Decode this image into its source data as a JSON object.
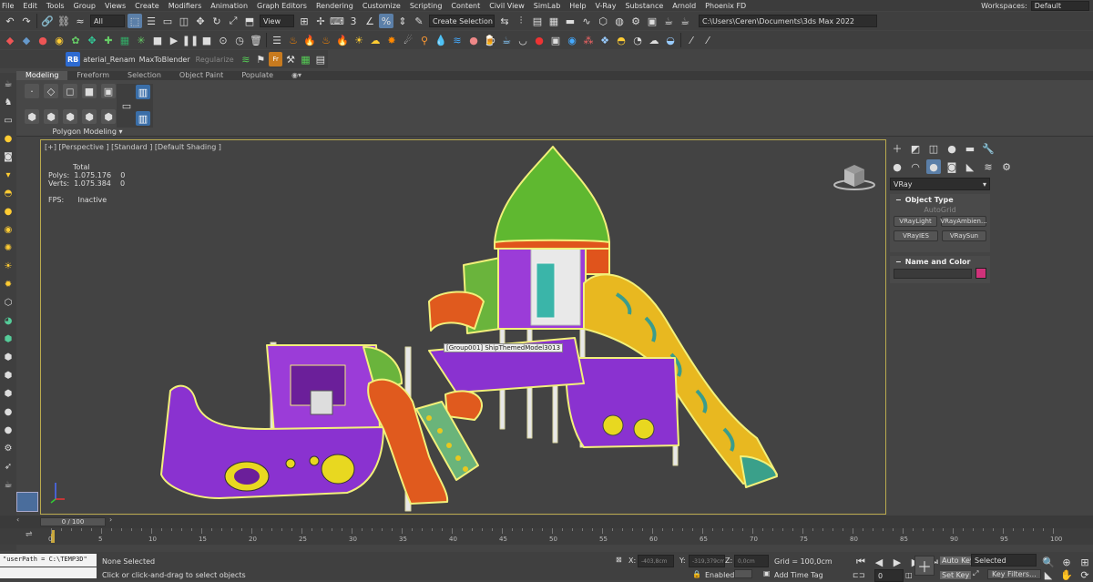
{
  "menu": {
    "items": [
      "File",
      "Edit",
      "Tools",
      "Group",
      "Views",
      "Create",
      "Modifiers",
      "Animation",
      "Graph Editors",
      "Rendering",
      "Customize",
      "Scripting",
      "Content",
      "Civil View",
      "SimLab",
      "Help",
      "V-Ray",
      "Substance",
      "Arnold",
      "Phoenix FD"
    ],
    "workspaces_label": "Workspaces:",
    "workspaces_value": "Default"
  },
  "toolbar1": {
    "filter": "All",
    "ref_coord": "View",
    "selection_set": "Create Selection Se",
    "path": "C:\\Users\\Ceren\\Documents\\3ds Max 2022"
  },
  "toolbar3": {
    "material_rename": "aterial_Renam",
    "max_to_blender": "MaxToBlender",
    "regularize": "Regularize"
  },
  "ribbon": {
    "tabs": [
      "Modeling",
      "Freeform",
      "Selection",
      "Object Paint",
      "Populate"
    ],
    "active": "Modeling",
    "panel": "Polygon Modeling"
  },
  "viewport": {
    "label": "[+] [Perspective ] [Standard ] [Default Shading ]",
    "stats": {
      "total": "Total",
      "polys_label": "Polys:",
      "polys_value": "1.075.176",
      "polys_sel": "0",
      "verts_label": "Verts:",
      "verts_value": "1.075.384",
      "verts_sel": "0",
      "fps_label": "FPS:",
      "fps_value": "Inactive"
    },
    "tooltip": "[Group001] ShipThemedModel3013"
  },
  "cmdpanel": {
    "category": "VRay",
    "object_type": "Object Type",
    "autogrid": "AutoGrid",
    "buttons": [
      "VRayLight",
      "VRayAmbien...",
      "VRayIES",
      "VRaySun"
    ],
    "name_color": "Name and Color",
    "color": "#d0327a"
  },
  "timeline": {
    "frame": "0 / 100",
    "ticks": [
      "0",
      "5",
      "10",
      "15",
      "20",
      "25",
      "30",
      "35",
      "40",
      "45",
      "50",
      "55",
      "60",
      "65",
      "70",
      "75",
      "80",
      "85",
      "90",
      "95",
      "100"
    ]
  },
  "status": {
    "maxscript": "\"userPath = C:\\TEMP3D\"",
    "selection": "None Selected",
    "prompt": "Click or click-and-drag to select objects",
    "x_label": "X:",
    "x_value": "-403,8cm",
    "y_label": "Y:",
    "y_value": "-319,379cm",
    "z_label": "Z:",
    "z_value": "0,0cm",
    "grid": "Grid = 100,0cm",
    "enabled": "Enabled:",
    "add_time_tag": "Add Time Tag",
    "auto_key": "Auto Key",
    "selected": "Selected",
    "set_key": "Set Key",
    "key_filters": "Key Filters...",
    "frame_field": "0"
  }
}
